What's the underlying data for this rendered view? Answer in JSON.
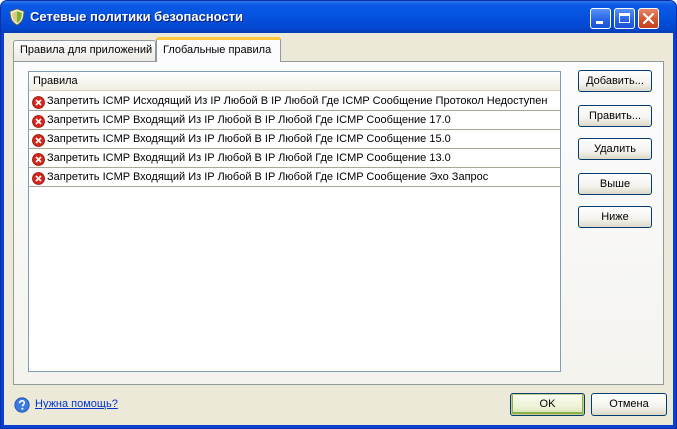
{
  "window": {
    "title": "Сетевые политики безопасности"
  },
  "tabs": [
    {
      "label": "Правила для приложений",
      "active": false
    },
    {
      "label": "Глобальные правила",
      "active": true
    }
  ],
  "rules": {
    "header": "Правила",
    "items": [
      {
        "text": "Запретить ICMP Исходящий Из IP Любой В IP Любой Где ICMP Сообщение Протокол Недоступен",
        "icon": "deny-icon"
      },
      {
        "text": "Запретить ICMP Входящий Из IP Любой В IP Любой Где ICMP Сообщение 17.0",
        "icon": "deny-icon"
      },
      {
        "text": "Запретить ICMP Входящий Из IP Любой В IP Любой Где ICMP Сообщение 15.0",
        "icon": "deny-icon"
      },
      {
        "text": "Запретить ICMP Входящий Из IP Любой В IP Любой Где ICMP Сообщение 13.0",
        "icon": "deny-icon"
      },
      {
        "text": "Запретить ICMP Входящий Из IP Любой В IP Любой Где ICMP Сообщение Эхо Запрос",
        "icon": "deny-icon"
      }
    ]
  },
  "side_buttons": {
    "add": "Добавить...",
    "edit": "Править...",
    "delete": "Удалить",
    "up": "Выше",
    "down": "Ниже"
  },
  "footer": {
    "help_link": "Нужна помощь?",
    "ok": "OK",
    "cancel": "Отмена"
  },
  "colors": {
    "titlebar": "#0553e0",
    "deny_icon": "#d8251c",
    "link": "#0033cc"
  }
}
